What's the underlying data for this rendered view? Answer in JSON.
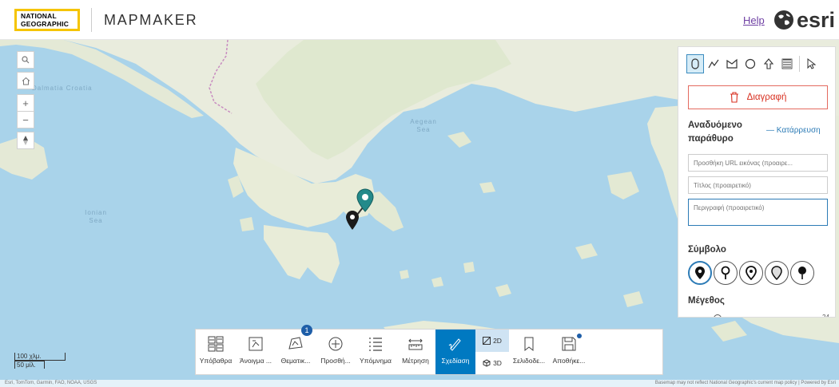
{
  "header": {
    "logo_lines": [
      "NATIONAL",
      "GEOGRAPHIC"
    ],
    "app_title": "MAPMAKER",
    "help_label": "Help",
    "esri_label": "esri"
  },
  "map": {
    "labels": [
      "Dalmatia Croatia",
      "Aegean Sea",
      "Ionian Sea"
    ],
    "controls": [
      "search-icon",
      "home-icon",
      "zoom-in",
      "zoom-out",
      "compass-icon"
    ],
    "zoom_in_label": "+",
    "zoom_out_label": "−"
  },
  "panel": {
    "tools": [
      "point-tool",
      "line-tool",
      "polygon-tool",
      "circle-tool",
      "arrow-tool",
      "text-tool",
      "select-tool"
    ],
    "active_tool": "point-tool",
    "delete_label": "Διαγραφή",
    "popup_label": "Αναδυόμενο παράθυρο",
    "collapse_label": "— Κατάρρευση",
    "image_url_placeholder": "Προσθήκη URL εικόνας (προαιρε...",
    "title_placeholder": "Τίτλος (προαιρετικό)",
    "description_placeholder": "Περιγραφή (προαιρετικό)",
    "symbol_label": "Σύμβολο",
    "size_label": "Μέγεθος",
    "size_value": "24",
    "accent_color": "#2c7bb6",
    "delete_color": "#d83020"
  },
  "toolbar": {
    "buttons": [
      {
        "label": "Υπόβαθρα",
        "icon": "basemap-icon"
      },
      {
        "label": "Άνοιγμα ...",
        "icon": "open-icon"
      },
      {
        "label": "Θεματικ...",
        "icon": "thematic-icon",
        "badge": "1"
      },
      {
        "label": "Προσθή...",
        "icon": "add-icon"
      },
      {
        "label": "Υπόμνημα",
        "icon": "legend-icon"
      },
      {
        "label": "Μέτρηση",
        "icon": "measure-icon"
      },
      {
        "label": "Σχεδίαση",
        "icon": "draw-icon",
        "active": true
      },
      {
        "label": "Σελιδοδε...",
        "icon": "bookmark-icon"
      },
      {
        "label": "Αποθήκε...",
        "icon": "save-icon"
      }
    ],
    "view_2d": "2D",
    "view_3d": "3D",
    "active_color": "#0079c1"
  },
  "scale": {
    "metric": "100 χλμ.",
    "imperial": "50 μίλ."
  },
  "attribution": {
    "left": "Esri, TomTom, Garmin, FAO, NOAA, USGS",
    "right": "Basemap may not reflect National Geographic's current map policy | Powered by Esri"
  }
}
